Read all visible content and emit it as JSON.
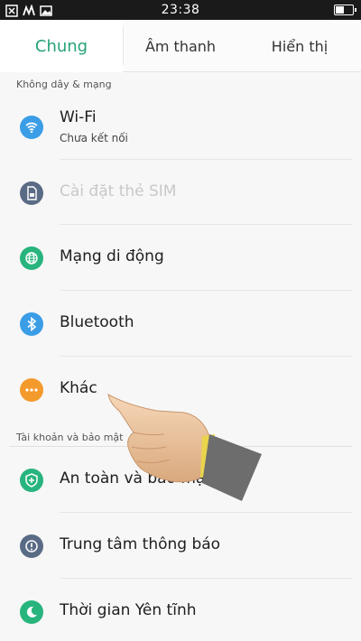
{
  "status_bar": {
    "time": "23:38",
    "battery_level": 0.5
  },
  "tabs": [
    {
      "label": "Chung",
      "active": true
    },
    {
      "label": "Âm thanh",
      "active": false
    },
    {
      "label": "Hiển thị",
      "active": false
    }
  ],
  "sections": [
    {
      "title": "Không dây & mạng"
    },
    {
      "title": "Tài khoản và bảo mật"
    }
  ],
  "items": [
    {
      "label": "Wi-Fi",
      "sub": "Chưa kết nối",
      "icon": "wifi-icon",
      "color": "#3a9de6"
    },
    {
      "label": "Cài đặt thẻ SIM",
      "icon": "sim-card-icon",
      "color": "#c9ced6",
      "disabled": true
    },
    {
      "label": "Mạng di động",
      "icon": "globe-icon",
      "color": "#28b47d"
    },
    {
      "label": "Bluetooth",
      "icon": "bluetooth-icon",
      "color": "#3a9de6"
    },
    {
      "label": "Khác",
      "icon": "more-icon",
      "color": "#f39a2c"
    },
    {
      "label": "An toàn và bảo mật",
      "icon": "shield-icon",
      "color": "#28b47d"
    },
    {
      "label": "Trung tâm thông báo",
      "icon": "alert-icon",
      "color": "#5a6b85"
    },
    {
      "label": "Thời gian Yên tĩnh",
      "icon": "moon-icon",
      "color": "#28b47d"
    }
  ],
  "colors": {
    "accent": "#26a377"
  }
}
